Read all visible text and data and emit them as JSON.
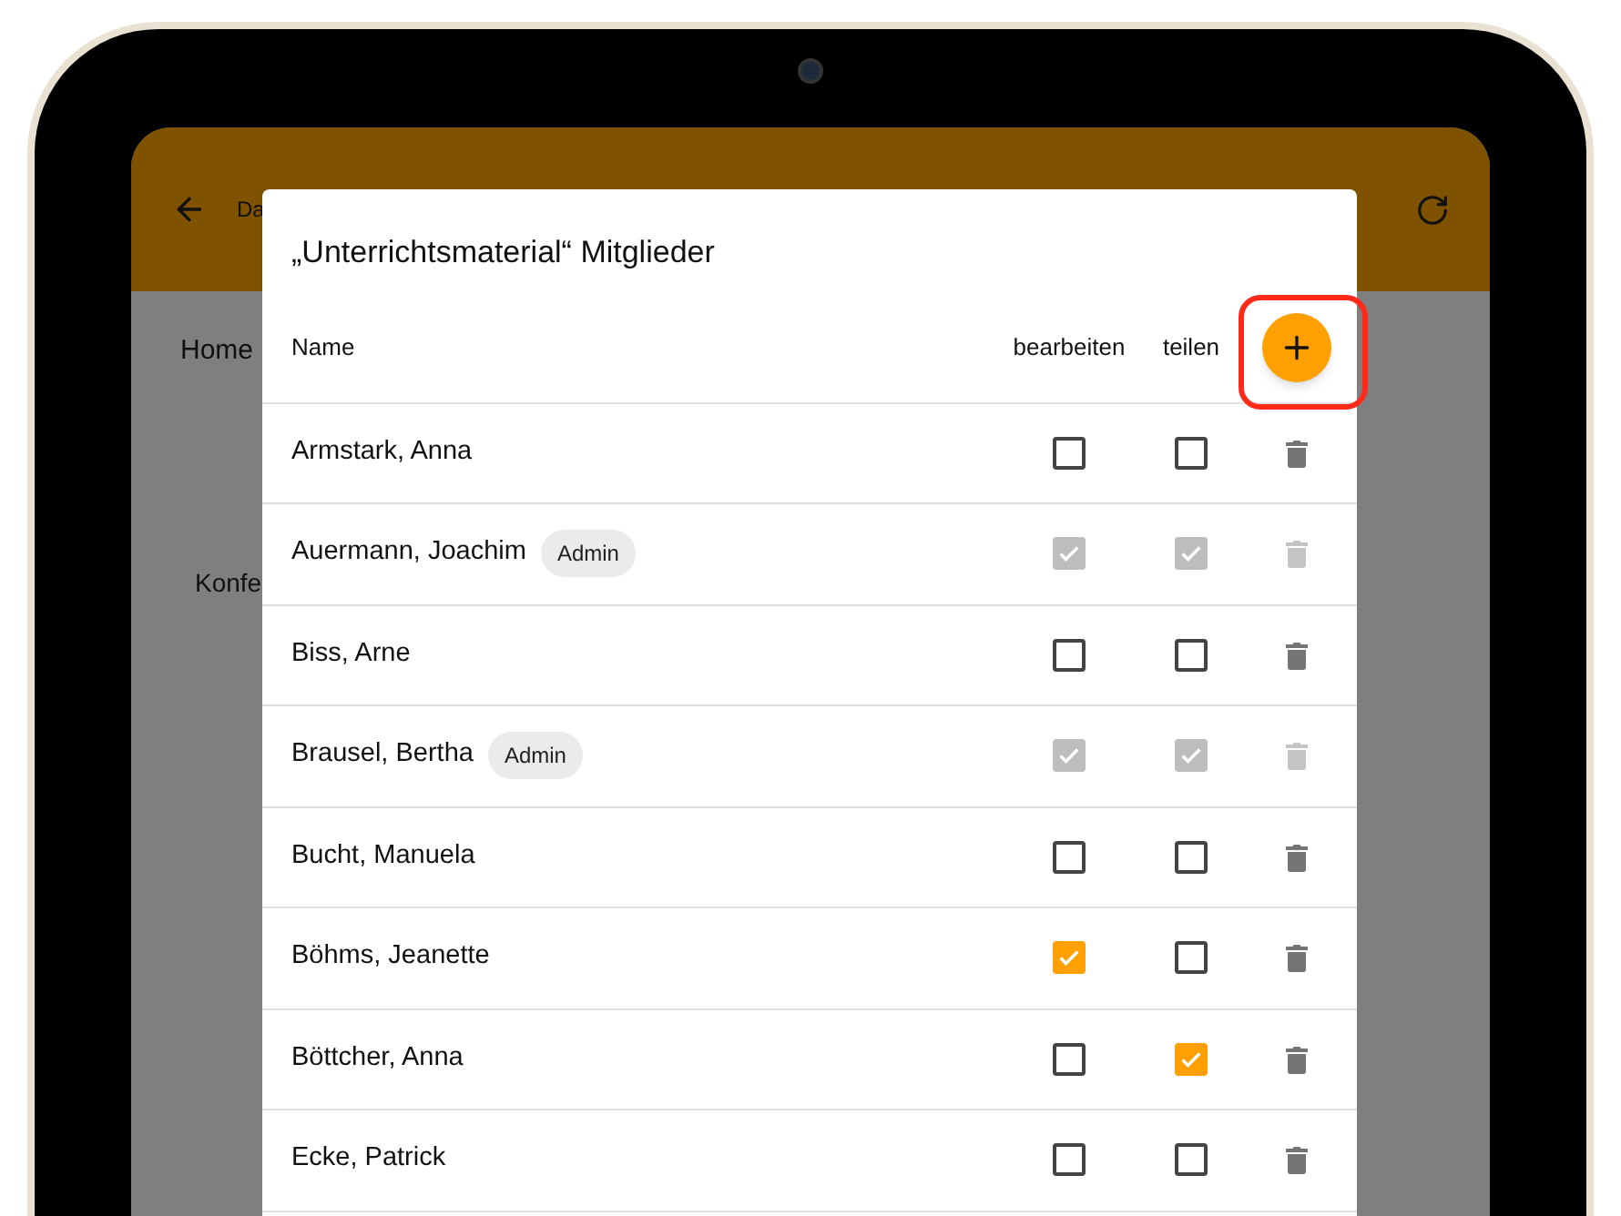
{
  "app_bar": {
    "title": "Da"
  },
  "background": {
    "breadcrumb": "Home",
    "label": "Konfe"
  },
  "dialog": {
    "title": "„Unterrichtsmaterial“ Mitglieder",
    "columns": [
      "Name",
      "bearbeiten",
      "teilen"
    ],
    "rows": [
      {
        "name": "Armstark, Anna",
        "edit": {
          "checked": false,
          "disabled": false
        },
        "share": {
          "checked": false,
          "disabled": false
        },
        "delete_disabled": false
      },
      {
        "name": "Auermann, Joachim",
        "badge": "Admin",
        "edit": {
          "checked": true,
          "disabled": true
        },
        "share": {
          "checked": true,
          "disabled": true
        },
        "delete_disabled": true
      },
      {
        "name": "Biss, Arne",
        "edit": {
          "checked": false,
          "disabled": false
        },
        "share": {
          "checked": false,
          "disabled": false
        },
        "delete_disabled": false
      },
      {
        "name": "Brausel, Bertha",
        "badge": "Admin",
        "edit": {
          "checked": true,
          "disabled": true
        },
        "share": {
          "checked": true,
          "disabled": true
        },
        "delete_disabled": true
      },
      {
        "name": "Bucht, Manuela",
        "edit": {
          "checked": false,
          "disabled": false
        },
        "share": {
          "checked": false,
          "disabled": false
        },
        "delete_disabled": false
      },
      {
        "name": "Böhms, Jeanette",
        "edit": {
          "checked": true,
          "disabled": false
        },
        "share": {
          "checked": false,
          "disabled": false
        },
        "delete_disabled": false
      },
      {
        "name": "Böttcher, Anna",
        "edit": {
          "checked": false,
          "disabled": false
        },
        "share": {
          "checked": true,
          "disabled": false
        },
        "delete_disabled": false
      },
      {
        "name": "Ecke, Patrick",
        "edit": {
          "checked": false,
          "disabled": false
        },
        "share": {
          "checked": false,
          "disabled": false
        },
        "delete_disabled": false
      }
    ]
  }
}
